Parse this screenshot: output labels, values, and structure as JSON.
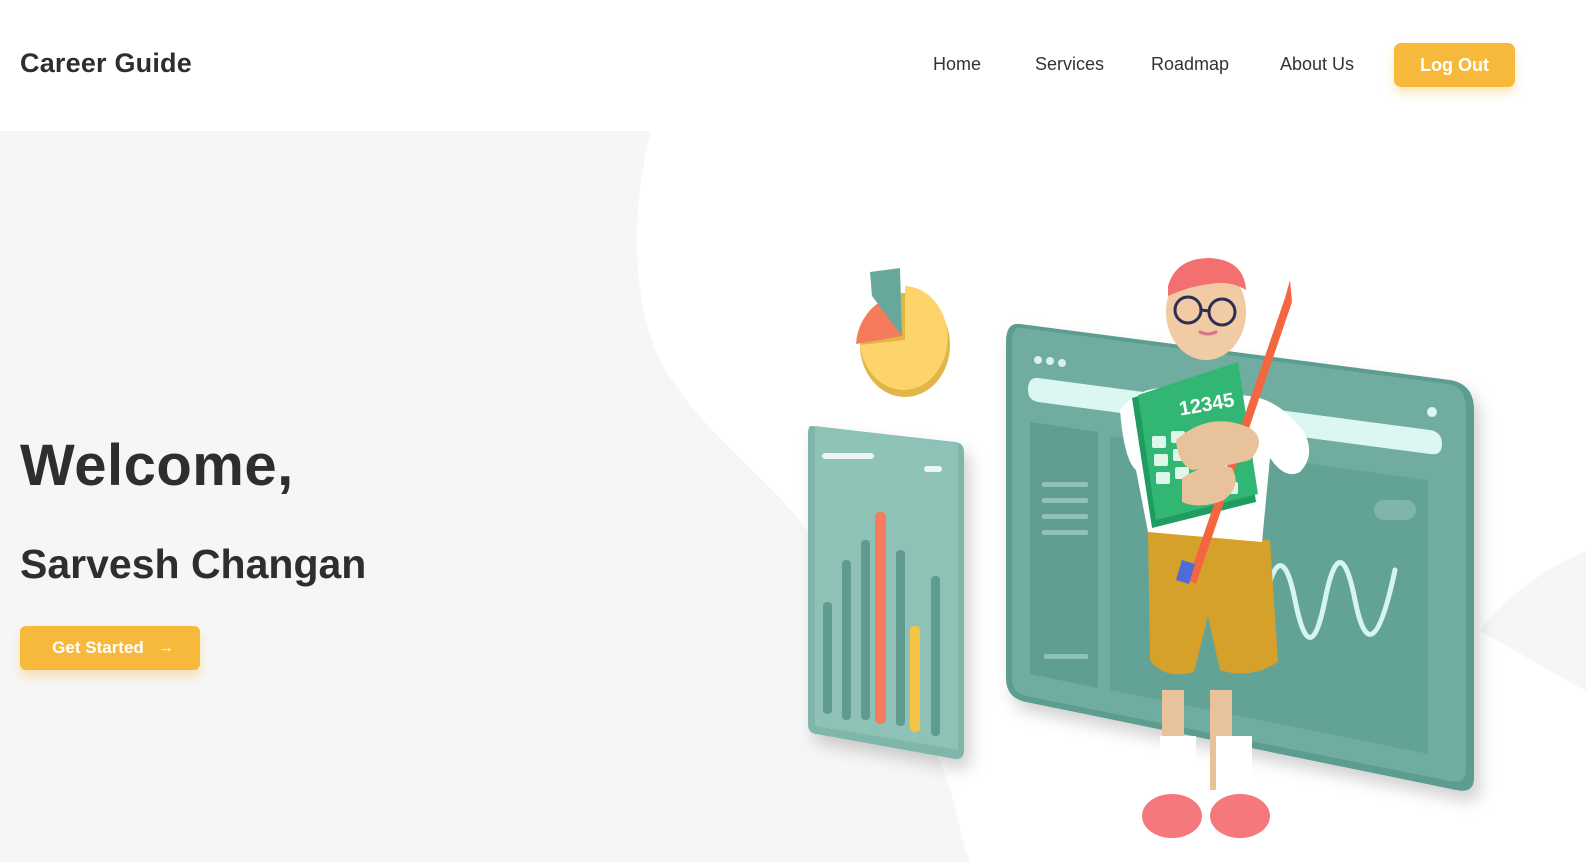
{
  "header": {
    "logo_text": "Career Guide",
    "nav": [
      {
        "label": "Home"
      },
      {
        "label": "Services"
      },
      {
        "label": "Roadmap"
      },
      {
        "label": "About Us"
      }
    ],
    "logout_label": "Log Out"
  },
  "hero": {
    "greeting": "Welcome,",
    "user_name": "Sarvesh Changan",
    "cta_label": "Get Started",
    "cta_icon": "arrow-right-icon",
    "calculator_display": "12345"
  },
  "colors": {
    "accent": "#f6b93b",
    "hero_background": "#f6f6f6",
    "teal": "#67a89a",
    "coral": "#f47b5c"
  }
}
